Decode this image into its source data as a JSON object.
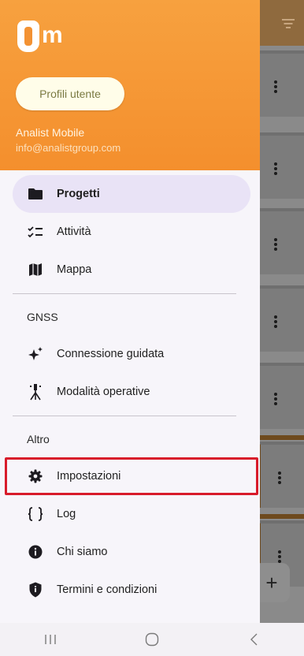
{
  "app": {
    "logo_text": "m"
  },
  "header": {
    "profile_button_label": "Profili utente",
    "user_name": "Analist Mobile",
    "user_email": "info@analistgroup.com",
    "background_color": "#f48f2d"
  },
  "menu": {
    "items_top": [
      {
        "label": "Progetti",
        "icon": "folder-icon",
        "active": true
      },
      {
        "label": "Attività",
        "icon": "checklist-icon"
      },
      {
        "label": "Mappa",
        "icon": "map-icon"
      }
    ],
    "gnss_section": "GNSS",
    "items_gnss": [
      {
        "label": "Connessione guidata",
        "icon": "sparkle-icon"
      },
      {
        "label": "Modalità operative",
        "icon": "survey-pole-icon"
      }
    ],
    "other_section": "Altro",
    "items_other": [
      {
        "label": "Impostazioni",
        "icon": "gear-icon",
        "highlighted": true
      },
      {
        "label": "Log",
        "icon": "braces-icon"
      },
      {
        "label": "Chi siamo",
        "icon": "info-icon"
      },
      {
        "label": "Termini e condizioni",
        "icon": "shield-icon"
      }
    ]
  },
  "background": {
    "fab_label": "+"
  },
  "colors": {
    "active_bg": "#e9e3f6",
    "highlight_outline": "#d81b2a"
  }
}
